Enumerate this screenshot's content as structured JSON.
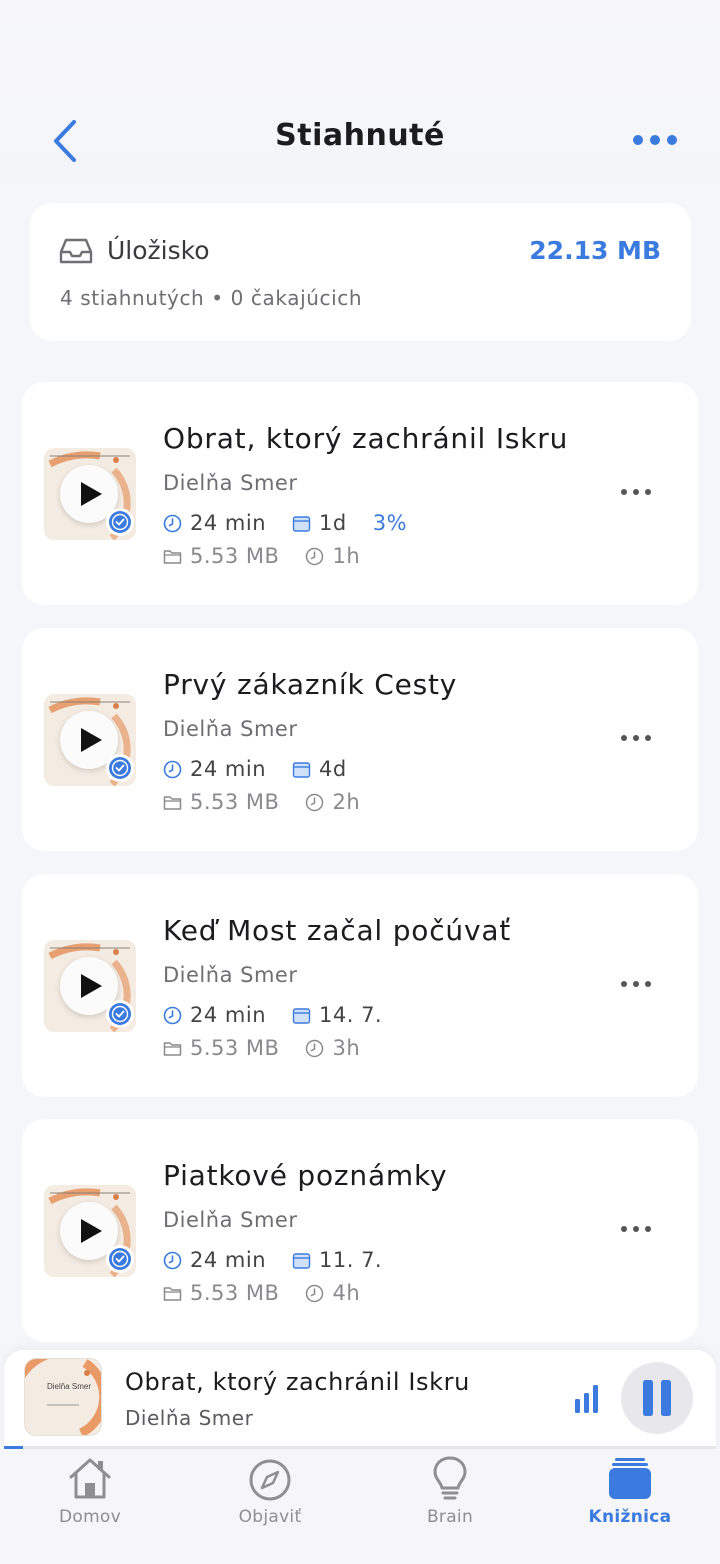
{
  "header": {
    "title": "Stiahnuté",
    "back_icon": "chevron-left-icon",
    "more_icon": "ellipsis-icon"
  },
  "storage": {
    "label": "Úložisko",
    "size": "22.13 MB",
    "summary": "4 stiahnutých • 0 čakajúcich",
    "icon": "tray-icon"
  },
  "episodes": [
    {
      "title": "Obrat, ktorý zachránil Iskru",
      "author": "Dielňa Smer",
      "duration": "24 min",
      "date": "1d",
      "progress": "3%",
      "size": "5.53 MB",
      "age": "1h"
    },
    {
      "title": "Prvý zákazník Cesty",
      "author": "Dielňa Smer",
      "duration": "24 min",
      "date": "4d",
      "progress": "",
      "size": "5.53 MB",
      "age": "2h"
    },
    {
      "title": "Keď Most začal počúvať",
      "author": "Dielňa Smer",
      "duration": "24 min",
      "date": "14. 7.",
      "progress": "",
      "size": "5.53 MB",
      "age": "3h"
    },
    {
      "title": "Piatkové poznámky",
      "author": "Dielňa Smer",
      "duration": "24 min",
      "date": "11. 7.",
      "progress": "",
      "size": "5.53 MB",
      "age": "4h"
    }
  ],
  "mini_player": {
    "title": "Obrat, ktorý zachránil Iskru",
    "author": "Dielňa Smer",
    "cover_text": "Dielňa Smer",
    "progress_fraction": 0.027,
    "state": "playing"
  },
  "tabs": [
    {
      "label": "Domov",
      "icon": "house-icon",
      "active": false
    },
    {
      "label": "Objaviť",
      "icon": "compass-icon",
      "active": false
    },
    {
      "label": "Brain",
      "icon": "lightbulb-icon",
      "active": false
    },
    {
      "label": "Knižnica",
      "icon": "library-icon",
      "active": true
    }
  ],
  "colors": {
    "accent": "#3b7be0",
    "background": "#f5f6fa",
    "card": "#ffffff",
    "cover": "#f4ece2",
    "cover_arc": "#e8915a"
  }
}
